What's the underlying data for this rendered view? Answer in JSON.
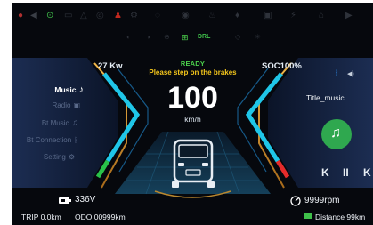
{
  "status_bar": {
    "telltales_top": [
      "seatbelt-icon",
      "warning-icon",
      "airbag-icon",
      "abs-icon",
      "battery-warning-icon",
      "engine-check-icon",
      "ready-lamp-icon",
      "turn-left-icon",
      "turn-right-icon"
    ],
    "telltales_second": [
      "parking-light-icon",
      "headlight-icon",
      "fog-light-icon",
      "high-beam-icon",
      "drl-icon"
    ],
    "drl_label": "DRL"
  },
  "header": {
    "power": "27 Kw",
    "ready": "READY",
    "message": "Please step on the brakes",
    "soc": "SOC100%"
  },
  "speedometer": {
    "speed": "100",
    "unit": "km/h"
  },
  "media_menu": {
    "items": [
      {
        "label": "Music",
        "active": true
      },
      {
        "label": "Radio",
        "active": false
      },
      {
        "label": "Bt Music",
        "active": false
      },
      {
        "label": "Bt Connection",
        "active": false
      },
      {
        "label": "Setting",
        "active": false
      }
    ]
  },
  "now_playing": {
    "title": "Title_music"
  },
  "bottom": {
    "battery_voltage": "336V",
    "trip": "TRIP 0.0km",
    "odo": "ODO 00999km",
    "rpm": "9999rpm",
    "distance": "Distance 99km"
  },
  "colors": {
    "accent_cyan": "#1fc6e8",
    "ready_green": "#4cd14c",
    "warning_yellow": "#f3c51b",
    "music_green": "#2fa84f",
    "gauge_red": "#e52b2b"
  }
}
